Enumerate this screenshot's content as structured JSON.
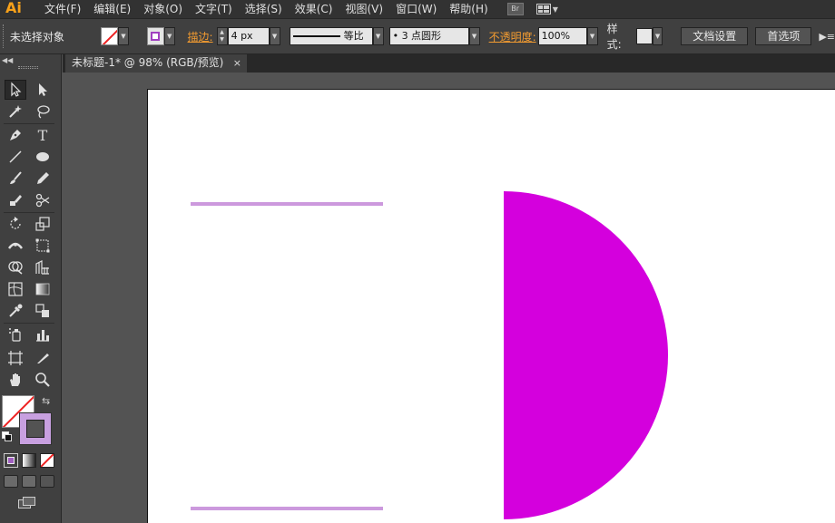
{
  "app": {
    "logo": "Ai",
    "bridge_label": "Br"
  },
  "menu": [
    {
      "label": "文件(F)"
    },
    {
      "label": "编辑(E)"
    },
    {
      "label": "对象(O)"
    },
    {
      "label": "文字(T)"
    },
    {
      "label": "选择(S)"
    },
    {
      "label": "效果(C)"
    },
    {
      "label": "视图(V)"
    },
    {
      "label": "窗口(W)"
    },
    {
      "label": "帮助(H)"
    }
  ],
  "control_bar": {
    "selection_state": "未选择对象",
    "stroke_label": "描边:",
    "stroke_weight": "4 px",
    "profile_label": "等比",
    "brush_label": "• 3 点圆形",
    "opacity_label": "不透明度:",
    "opacity_value": "100%",
    "style_label": "样式:",
    "doc_setup_button": "文档设置",
    "prefs_button": "首选项"
  },
  "document_tab": {
    "title": "未标题-1* @ 98% (RGB/预览)",
    "close_glyph": "×"
  },
  "tools": [
    {
      "name": "selection-tool-icon"
    },
    {
      "name": "direct-selection-tool-icon"
    },
    {
      "name": "magic-wand-tool-icon"
    },
    {
      "name": "lasso-tool-icon"
    },
    {
      "name": "pen-tool-icon"
    },
    {
      "name": "type-tool-icon",
      "glyph": "T"
    },
    {
      "name": "line-segment-tool-icon"
    },
    {
      "name": "ellipse-tool-icon"
    },
    {
      "name": "paintbrush-tool-icon"
    },
    {
      "name": "pencil-tool-icon"
    },
    {
      "name": "blob-brush-tool-icon"
    },
    {
      "name": "scissors-tool-icon"
    },
    {
      "name": "rotate-tool-icon"
    },
    {
      "name": "scale-tool-icon"
    },
    {
      "name": "width-tool-icon"
    },
    {
      "name": "free-transform-tool-icon"
    },
    {
      "name": "shape-builder-tool-icon"
    },
    {
      "name": "perspective-grid-tool-icon"
    },
    {
      "name": "mesh-tool-icon"
    },
    {
      "name": "gradient-tool-icon"
    },
    {
      "name": "eyedropper-tool-icon"
    },
    {
      "name": "blend-tool-icon"
    },
    {
      "name": "symbol-sprayer-tool-icon"
    },
    {
      "name": "column-graph-tool-icon"
    },
    {
      "name": "artboard-tool-icon"
    },
    {
      "name": "slice-tool-icon"
    },
    {
      "name": "hand-tool-icon"
    },
    {
      "name": "zoom-tool-icon"
    }
  ],
  "colors": {
    "accent_orange": "#f29b30",
    "line_color": "#cc99dd",
    "semicircle_fill": "#d400dd",
    "stroke_swatch": "#c8a0e0"
  },
  "zoom_level": "98%"
}
